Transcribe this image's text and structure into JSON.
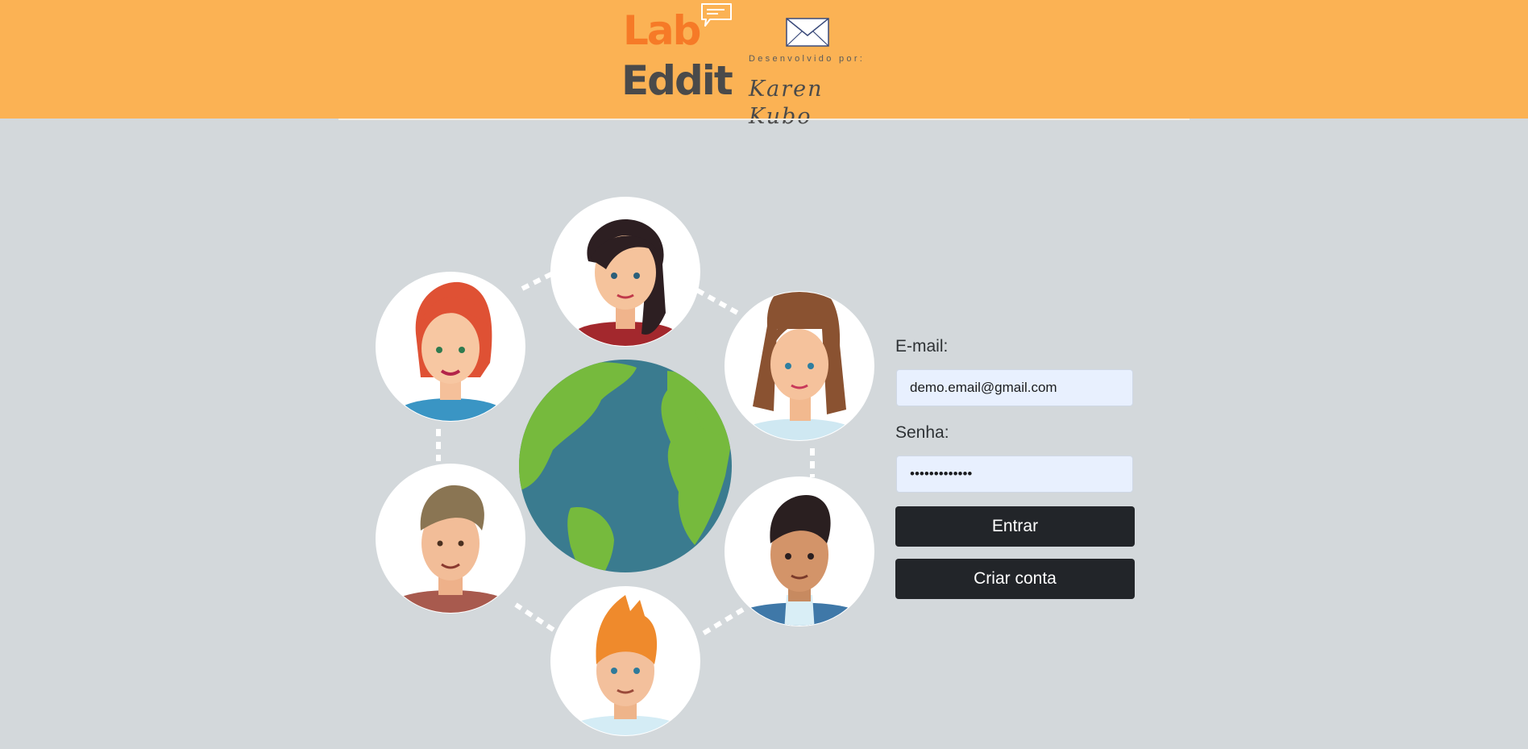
{
  "header": {
    "logo": {
      "line1": "Lab",
      "line2": "Eddit",
      "developed_by": "Desenvolvido por:",
      "developer_signature": "Karen Kubo"
    }
  },
  "login_form": {
    "email_label": "E-mail:",
    "email_value": "demo.email@gmail.com",
    "password_label": "Senha:",
    "password_value": "demo.password",
    "login_button": "Entrar",
    "signup_button": "Criar conta"
  },
  "colors": {
    "header_bg": "#fbb254",
    "page_bg": "#d3d8db",
    "logo_lab": "#f67a27",
    "logo_eddit": "#4a4a4a",
    "button_bg": "#222529",
    "input_bg": "#e8f0fe"
  }
}
